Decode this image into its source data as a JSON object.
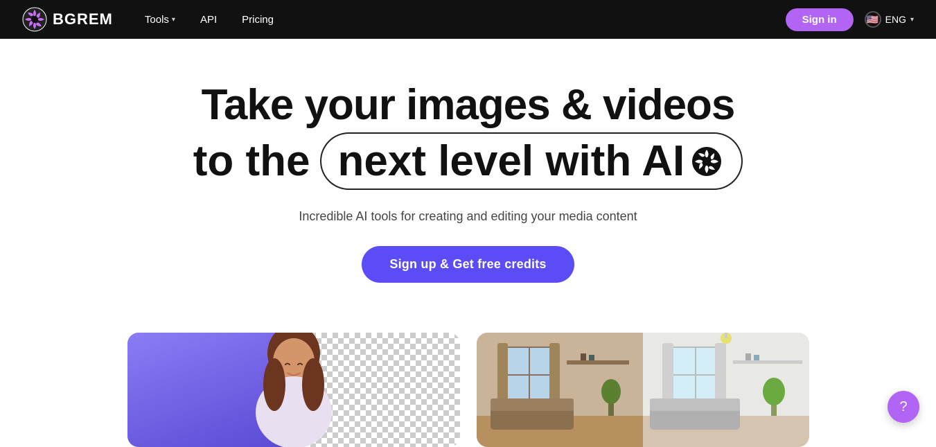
{
  "brand": {
    "name": "BGREM",
    "logo_alt": "BGREM logo"
  },
  "navbar": {
    "tools_label": "Tools",
    "api_label": "API",
    "pricing_label": "Pricing",
    "signin_label": "Sign in",
    "lang_label": "ENG"
  },
  "hero": {
    "title_line1": "Take your images & videos",
    "title_line2_prefix": "to the",
    "title_highlight": "next level with AI",
    "subtitle": "Incredible AI tools for creating and editing your media content",
    "cta_label": "Sign up & Get free credits"
  },
  "support": {
    "label": "?"
  }
}
